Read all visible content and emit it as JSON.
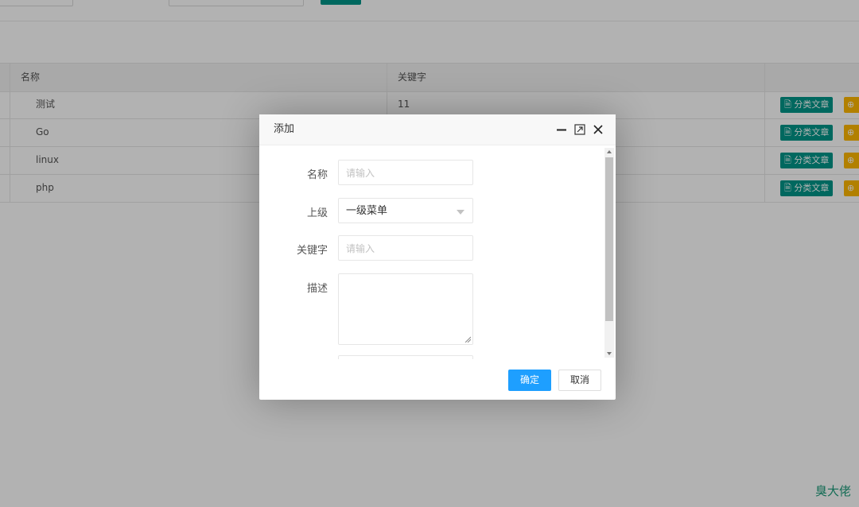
{
  "table": {
    "headers": [
      "名称",
      "关键字"
    ],
    "rows": [
      {
        "name": "测试",
        "keyword": "11"
      },
      {
        "name": "Go",
        "keyword": ""
      },
      {
        "name": "linux",
        "keyword": ""
      },
      {
        "name": "php",
        "keyword": ""
      }
    ],
    "category_button_label": "分类文章"
  },
  "modal": {
    "title": "添加",
    "fields": {
      "name": {
        "label": "名称",
        "placeholder": "请输入"
      },
      "parent": {
        "label": "上级",
        "value": "一级菜单"
      },
      "keyword": {
        "label": "关键字",
        "placeholder": "请输入"
      },
      "description": {
        "label": "描述"
      }
    },
    "confirm_label": "确定",
    "cancel_label": "取消"
  },
  "watermark": "臭大佬",
  "colors": {
    "primary": "#009688",
    "accent": "#1e9fff",
    "warning": "#ffb800"
  }
}
